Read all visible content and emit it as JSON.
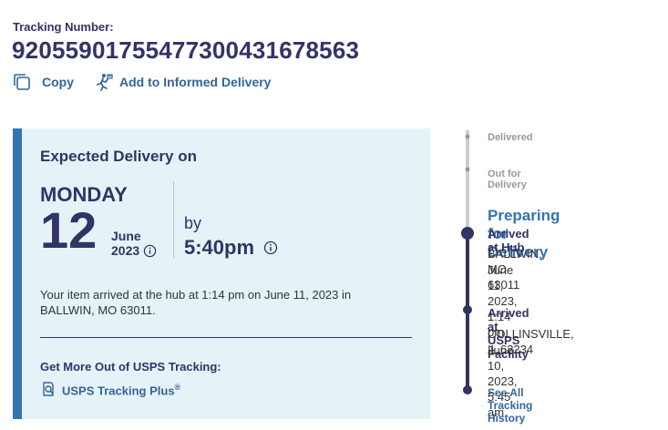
{
  "tracking": {
    "label": "Tracking Number:",
    "number": "9205590175547730043167856​3"
  },
  "actions": {
    "copy_label": "Copy",
    "informed_label": "Add to Informed Delivery"
  },
  "expected": {
    "title": "Expected Delivery on",
    "day": "MONDAY",
    "date": "12",
    "month": "June",
    "year": "2023",
    "by": "by",
    "time": "5:40pm",
    "message": "Your item arrived at the hub at 1:14 pm on June 11, 2023 in BALLWIN, MO 63011."
  },
  "promo": {
    "title": "Get More Out of USPS Tracking:",
    "link_label": "USPS Tracking Plus",
    "link_sup": "®"
  },
  "timeline": {
    "steps": [
      {
        "label": "Delivered"
      },
      {
        "label": "Out for Delivery"
      },
      {
        "label": "Preparing for Delivery"
      }
    ],
    "events": [
      {
        "title": "Arrived at Hub",
        "location": "BALLWIN, MO 63011",
        "datetime": "June 11, 2023, 1:14 pm"
      },
      {
        "title": "Arrived at USPS Facility",
        "location": "COLLINSVILLE, IL 62234",
        "datetime": "June 10, 2023, 5:45 am"
      }
    ],
    "history_link": "See All Tracking History"
  },
  "colors": {
    "navy": "#333366",
    "link_blue": "#336699",
    "accent_blue": "#3573b1",
    "card_bg": "#e5f3f8",
    "muted_line": "#cccccc"
  },
  "icons": [
    "copy-icon",
    "informed-delivery-icon",
    "info-icon",
    "tracking-plus-icon"
  ]
}
